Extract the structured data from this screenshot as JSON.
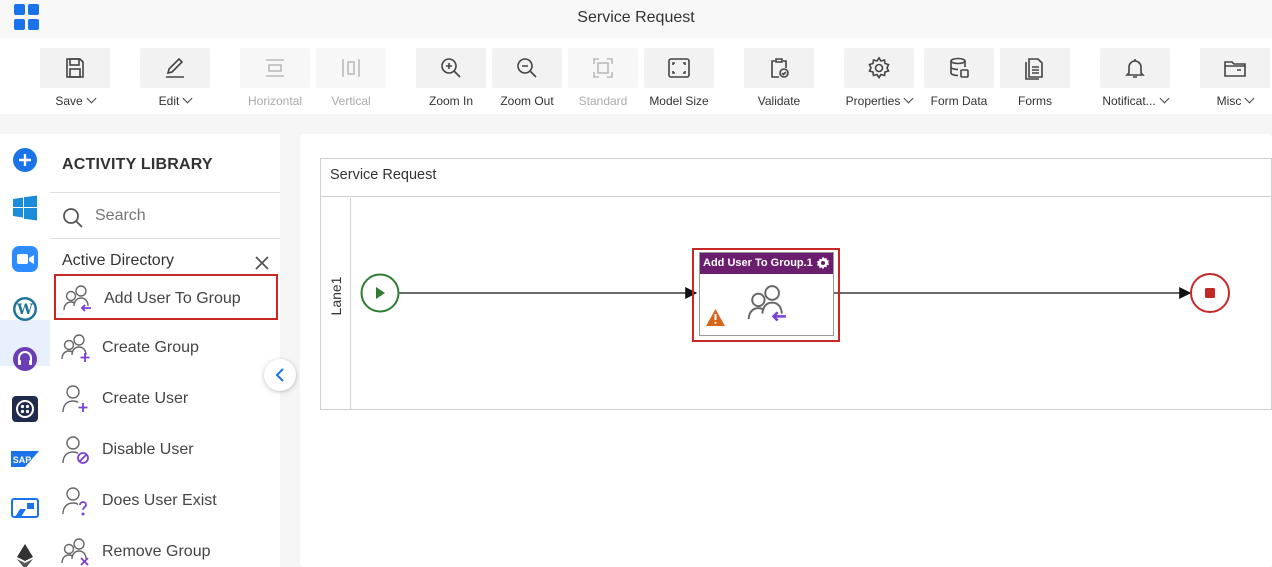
{
  "app": {
    "title": "Service Request"
  },
  "toolbar": {
    "items": [
      {
        "label": "Save",
        "icon": "save-icon",
        "dropdown": true,
        "enabled": true
      },
      {
        "label": "Edit",
        "icon": "edit-icon",
        "dropdown": true,
        "enabled": true
      },
      {
        "label": "Horizontal",
        "icon": "horizontal-icon",
        "dropdown": false,
        "enabled": false
      },
      {
        "label": "Vertical",
        "icon": "vertical-icon",
        "dropdown": false,
        "enabled": false
      },
      {
        "label": "Zoom In",
        "icon": "zoom-in-icon",
        "dropdown": false,
        "enabled": true
      },
      {
        "label": "Zoom Out",
        "icon": "zoom-out-icon",
        "dropdown": false,
        "enabled": true
      },
      {
        "label": "Standard",
        "icon": "standard-icon",
        "dropdown": false,
        "enabled": false
      },
      {
        "label": "Model Size",
        "icon": "model-size-icon",
        "dropdown": false,
        "enabled": true
      },
      {
        "label": "Validate",
        "icon": "validate-icon",
        "dropdown": false,
        "enabled": true
      },
      {
        "label": "Properties",
        "icon": "gear-icon",
        "dropdown": true,
        "enabled": true
      },
      {
        "label": "Form Data",
        "icon": "database-icon",
        "dropdown": false,
        "enabled": true
      },
      {
        "label": "Forms",
        "icon": "forms-icon",
        "dropdown": false,
        "enabled": true
      },
      {
        "label": "Notificat...",
        "icon": "bell-icon",
        "dropdown": true,
        "enabled": true
      },
      {
        "label": "Misc",
        "icon": "folder-icon",
        "dropdown": true,
        "enabled": true
      }
    ]
  },
  "rail": {
    "items": [
      "add-icon",
      "windows-icon",
      "zoom-app-icon",
      "wordpress-icon",
      "headset-icon",
      "twilio-icon",
      "sap-icon",
      "power-automate-icon",
      "ethereum-icon"
    ],
    "sap_text": "SAP"
  },
  "library": {
    "title": "ACTIVITY LIBRARY",
    "search_placeholder": "Search",
    "category": "Active Directory",
    "items": [
      {
        "label": "Add User To Group",
        "selected": true
      },
      {
        "label": "Create Group",
        "selected": false
      },
      {
        "label": "Create User",
        "selected": false
      },
      {
        "label": "Disable User",
        "selected": false
      },
      {
        "label": "Does User Exist",
        "selected": false
      },
      {
        "label": "Remove Group",
        "selected": false
      }
    ]
  },
  "canvas": {
    "pool_title": "Service Request",
    "lane_label": "Lane1",
    "activity": {
      "title": "Add User To Group.1",
      "has_warning": true
    },
    "colors": {
      "start": "#2e7d32",
      "end": "#c62828",
      "activity_header": "#6b1d6e",
      "selection": "#c62828"
    }
  }
}
